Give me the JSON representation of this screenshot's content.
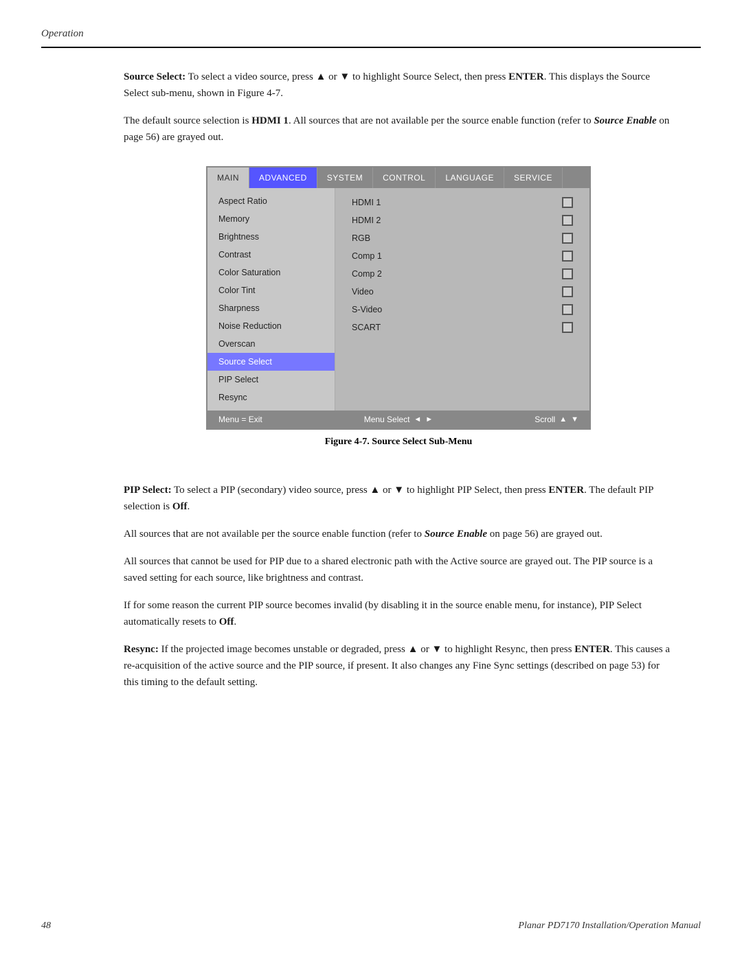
{
  "header": {
    "label": "Operation"
  },
  "paragraphs": {
    "source_select_p1": "Source Select: To select a video source, press ▲ or ▼ to highlight Source Select, then press ENTER. This displays the Source Select sub-menu, shown in Figure 4-7.",
    "source_select_p2_plain": "The default source selection is ",
    "source_select_p2_bold": "HDMI 1",
    "source_select_p2_rest": ". All sources that are not available per the source enable function (refer to ",
    "source_select_p2_italic": "Source Enable",
    "source_select_p2_end": " on page 56) are grayed out.",
    "pip_select_intro": "PIP Select: To select a PIP (secondary) video source, press ▲ or ▼ to highlight PIP Select, then press ENTER. The default PIP selection is ",
    "pip_select_off": "Off",
    "pip_select_end": ".",
    "pip_p2": "All sources that are not available per the source enable function (refer to ",
    "pip_p2_bold": "Source Enable",
    "pip_p2_end": " on page 56) are grayed out.",
    "pip_p3": "All sources that cannot be used for PIP due to a shared electronic path with the Active source are grayed out. The PIP source is a saved setting for each source, like brightness and contrast.",
    "pip_p4": "If for some reason the current PIP source becomes invalid (by disabling it in the source enable menu, for instance), PIP Select automatically resets to ",
    "pip_p4_bold": "Off",
    "pip_p4_end": ".",
    "resync_intro": "Resync: If the projected image becomes unstable or degraded, press ▲ or ▼ to highlight Resync, then press ",
    "resync_bold": "ENTER",
    "resync_rest": ". This causes a re-acquisition of the active source and the PIP source, if present. It also changes any Fine Sync settings (described on page 53) for this timing to the default setting."
  },
  "osd": {
    "tabs": [
      {
        "label": "MAIN",
        "active": false,
        "light": true
      },
      {
        "label": "ADVANCED",
        "active": true,
        "light": false
      },
      {
        "label": "SYSTEM",
        "active": false,
        "light": false
      },
      {
        "label": "CONTROL",
        "active": false,
        "light": false
      },
      {
        "label": "LANGUAGE",
        "active": false,
        "light": false
      },
      {
        "label": "SERVICE",
        "active": false,
        "light": false
      }
    ],
    "menu_items": [
      {
        "label": "Aspect Ratio",
        "selected": false
      },
      {
        "label": "Memory",
        "selected": false
      },
      {
        "label": "Brightness",
        "selected": false
      },
      {
        "label": "Contrast",
        "selected": false
      },
      {
        "label": "Color Saturation",
        "selected": false
      },
      {
        "label": "Color Tint",
        "selected": false
      },
      {
        "label": "Sharpness",
        "selected": false
      },
      {
        "label": "Noise Reduction",
        "selected": false
      },
      {
        "label": "Overscan",
        "selected": false
      },
      {
        "label": "Source Select",
        "selected": true
      },
      {
        "label": "PIP Select",
        "selected": false
      },
      {
        "label": "Resync",
        "selected": false
      }
    ],
    "sources": [
      {
        "label": "HDMI 1"
      },
      {
        "label": "HDMI 2"
      },
      {
        "label": "RGB"
      },
      {
        "label": "Comp 1"
      },
      {
        "label": "Comp 2"
      },
      {
        "label": "Video"
      },
      {
        "label": "S-Video"
      },
      {
        "label": "SCART"
      }
    ],
    "footer": {
      "menu_exit": "Menu = Exit",
      "menu_select": "Menu Select",
      "scroll": "Scroll"
    }
  },
  "figure_caption": "Figure 4-7. Source Select Sub-Menu",
  "footer": {
    "page_number": "48",
    "title": "Planar PD7170 Installation/Operation Manual"
  }
}
